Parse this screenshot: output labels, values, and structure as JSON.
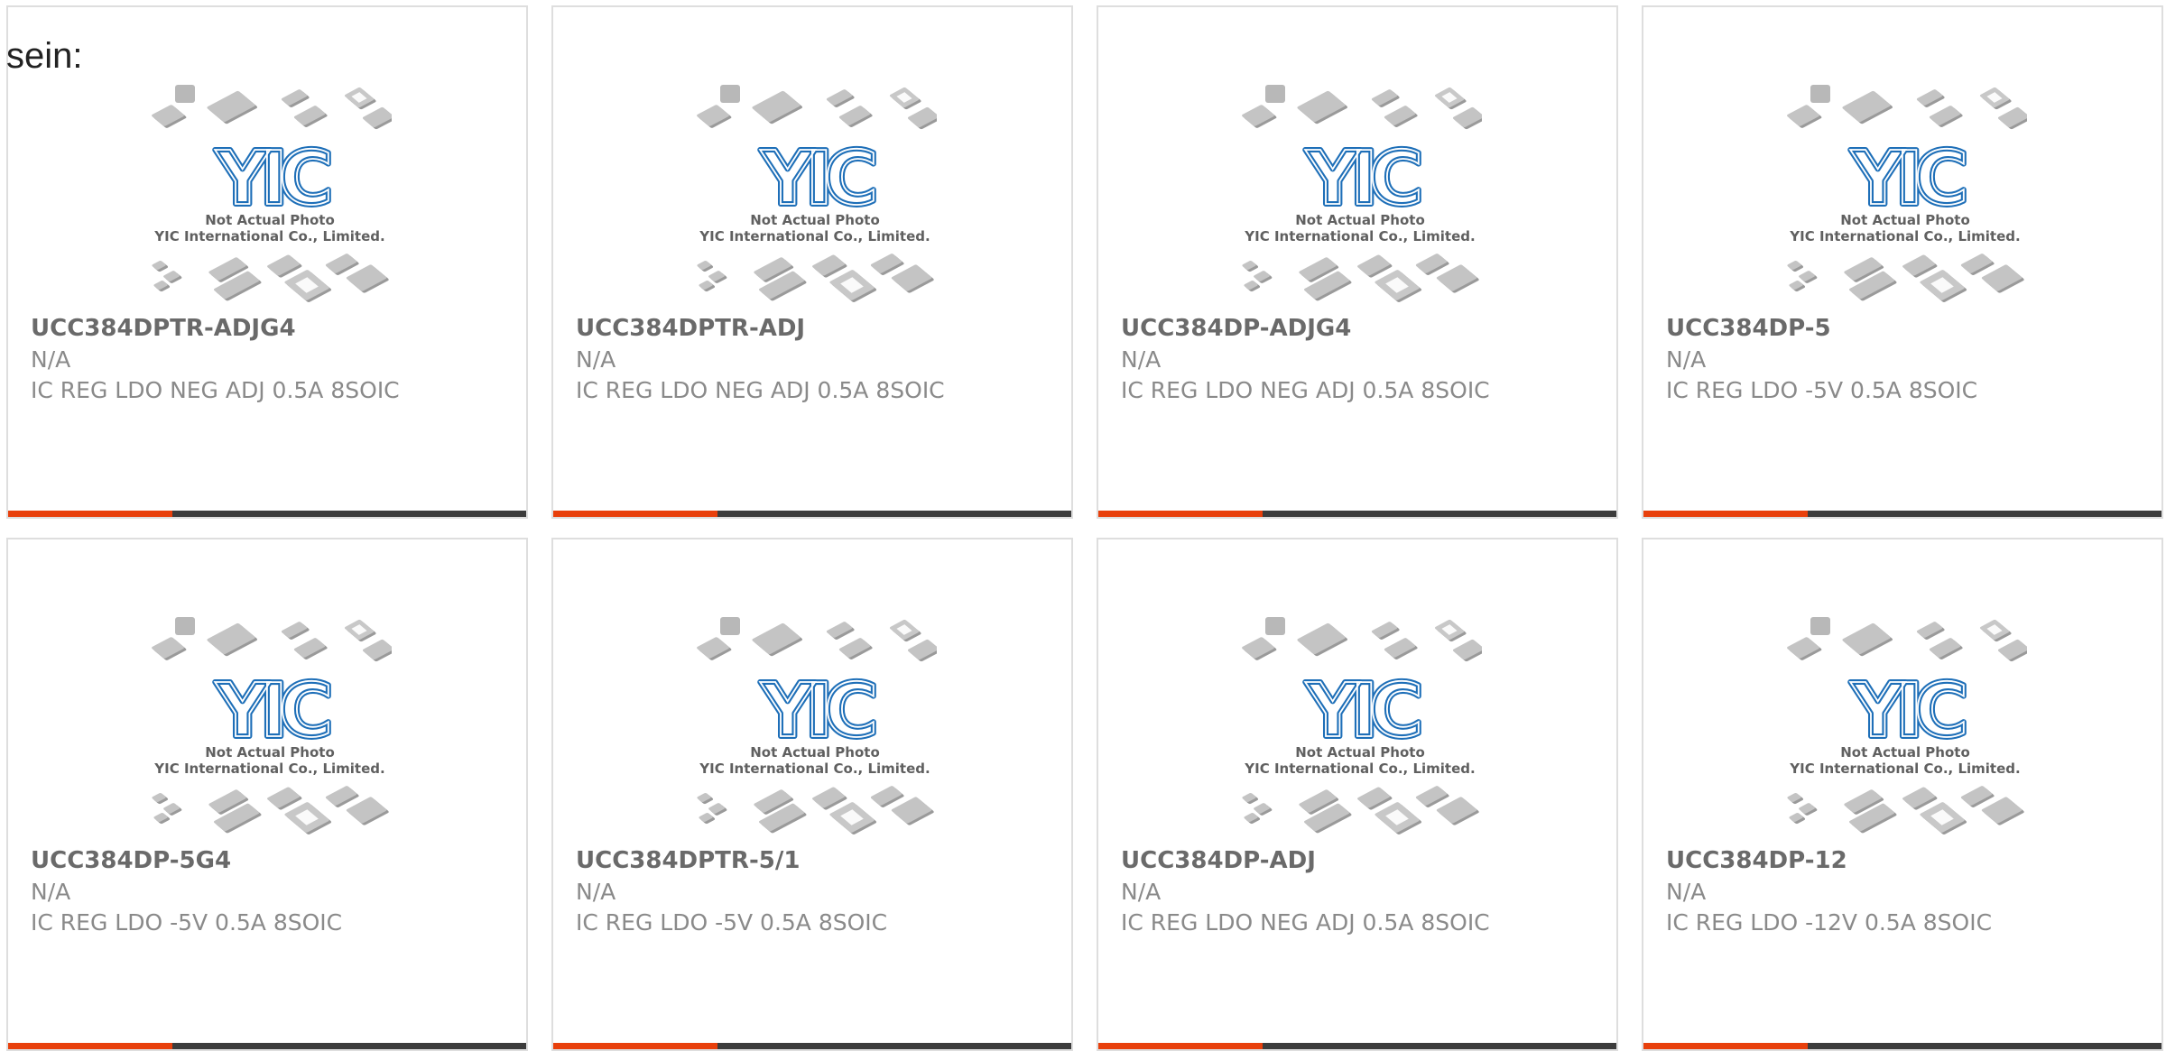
{
  "page": {
    "heading": "sein:"
  },
  "colors": {
    "accent_bar": "#e8400c",
    "dark_bar": "#3c3c3c",
    "logo_blue": "#1e6fb8"
  },
  "placeholder_image": {
    "logo_text": "YIC",
    "line1": "Not Actual Photo",
    "line2": "YIC International Co., Limited."
  },
  "products": [
    {
      "part": "UCC384DPTR-ADJG4",
      "manufacturer": "N/A",
      "description": "IC REG LDO NEG ADJ 0.5A 8SOIC"
    },
    {
      "part": "UCC384DPTR-ADJ",
      "manufacturer": "N/A",
      "description": "IC REG LDO NEG ADJ 0.5A 8SOIC"
    },
    {
      "part": "UCC384DP-ADJG4",
      "manufacturer": "N/A",
      "description": "IC REG LDO NEG ADJ 0.5A 8SOIC"
    },
    {
      "part": "UCC384DP-5",
      "manufacturer": "N/A",
      "description": "IC REG LDO -5V 0.5A 8SOIC"
    },
    {
      "part": "UCC384DP-5G4",
      "manufacturer": "N/A",
      "description": "IC REG LDO -5V 0.5A 8SOIC"
    },
    {
      "part": "UCC384DPTR-5/1",
      "manufacturer": "N/A",
      "description": "IC REG LDO -5V 0.5A 8SOIC"
    },
    {
      "part": "UCC384DP-ADJ",
      "manufacturer": "N/A",
      "description": "IC REG LDO NEG ADJ 0.5A 8SOIC"
    },
    {
      "part": "UCC384DP-12",
      "manufacturer": "N/A",
      "description": "IC REG LDO -12V 0.5A 8SOIC"
    }
  ]
}
